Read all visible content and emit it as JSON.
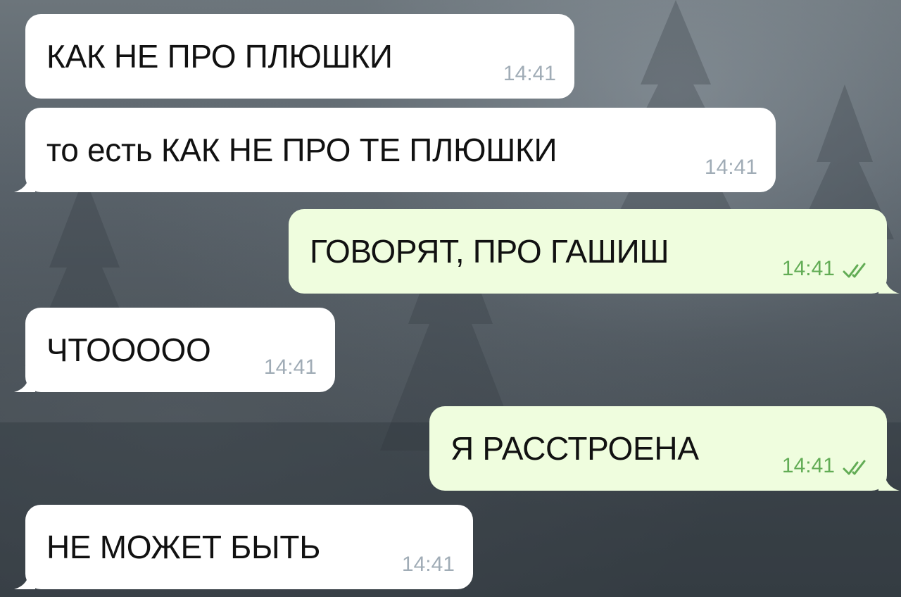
{
  "chat": {
    "messages": [
      {
        "direction": "in",
        "text": "КАК НЕ ПРО ПЛЮШКИ",
        "time": "14:41"
      },
      {
        "direction": "in",
        "text": "то есть КАК НЕ ПРО ТЕ ПЛЮШКИ",
        "time": "14:41"
      },
      {
        "direction": "out",
        "text": "ГОВОРЯТ, ПРО ГАШИШ",
        "time": "14:41",
        "status": "read"
      },
      {
        "direction": "in",
        "text": "ЧТООООО",
        "time": "14:41"
      },
      {
        "direction": "out",
        "text": "Я РАССТРОЕНА",
        "time": "14:41",
        "status": "read"
      },
      {
        "direction": "in",
        "text": "НЕ МОЖЕТ БЫТЬ",
        "time": "14:41"
      }
    ]
  },
  "colors": {
    "incoming_bubble": "#ffffff",
    "outgoing_bubble": "#effdde",
    "outgoing_meta": "#62ac55",
    "incoming_meta": "#a0acb6"
  }
}
